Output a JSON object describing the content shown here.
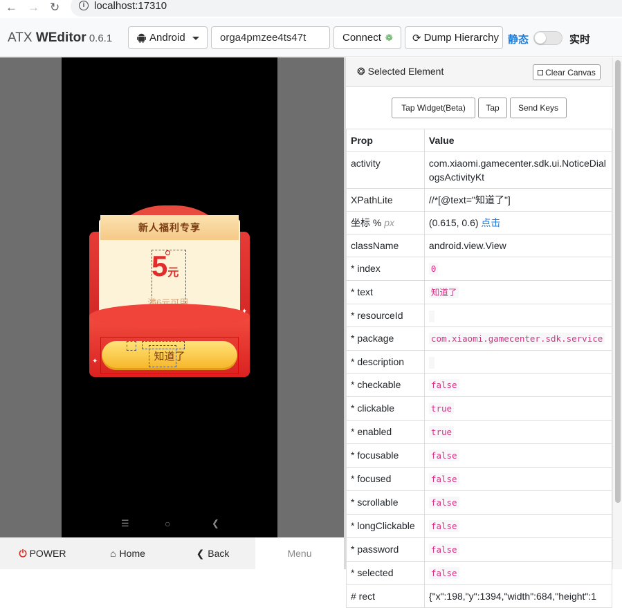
{
  "browser": {
    "url": "localhost:17310",
    "info_icon": "i"
  },
  "header": {
    "brand_prefix": "ATX ",
    "brand_name": "WEditor",
    "version": " 0.6.1",
    "platform": "Android",
    "serial": "orga4pmzee4ts47t",
    "connect_label": "Connect",
    "dump_label": "Dump Hierarchy",
    "mode_static": "静态",
    "mode_live": "实时",
    "live_mode_on": false
  },
  "device": {
    "popup": {
      "title": "新人福利专享",
      "amount": "5",
      "currency": "元",
      "condition": "满6元可用",
      "button": "知道了"
    },
    "controls": {
      "power": "POWER",
      "home": "Home",
      "back": "Back",
      "menu": "Menu"
    }
  },
  "inspector": {
    "title": "Selected Element",
    "clear_canvas": "Clear Canvas",
    "actions": [
      "Tap Widget(Beta)",
      "Tap",
      "Send Keys"
    ],
    "columns": [
      "Prop",
      "Value"
    ],
    "coord_label": "坐标 %",
    "coord_unit": "px",
    "coord_value": "(0.615, 0.6)",
    "coord_link": "点击",
    "rows": [
      {
        "prop": "activity",
        "value": "com.xiaomi.gamecenter.sdk.ui.NoticeDialogsActivityKt",
        "style": "plain"
      },
      {
        "prop": "XPathLite",
        "value": "//*[@text=\"知道了\"]",
        "style": "plain"
      },
      {
        "prop": "className",
        "value": "android.view.View",
        "style": "plain"
      },
      {
        "prop": "* index",
        "value": "0",
        "style": "code"
      },
      {
        "prop": "* text",
        "value": "知道了",
        "style": "code"
      },
      {
        "prop": "* resourceId",
        "value": "",
        "style": "code"
      },
      {
        "prop": "* package",
        "value": "com.xiaomi.gamecenter.sdk.service",
        "style": "code"
      },
      {
        "prop": "* description",
        "value": "",
        "style": "code"
      },
      {
        "prop": "* checkable",
        "value": "false",
        "style": "code"
      },
      {
        "prop": "* clickable",
        "value": "true",
        "style": "code"
      },
      {
        "prop": "* enabled",
        "value": "true",
        "style": "code"
      },
      {
        "prop": "* focusable",
        "value": "false",
        "style": "code"
      },
      {
        "prop": "* focused",
        "value": "false",
        "style": "code"
      },
      {
        "prop": "* scrollable",
        "value": "false",
        "style": "code"
      },
      {
        "prop": "* longClickable",
        "value": "false",
        "style": "code"
      },
      {
        "prop": "* password",
        "value": "false",
        "style": "code"
      },
      {
        "prop": "* selected",
        "value": "false",
        "style": "code"
      },
      {
        "prop": "# rect",
        "value": "{\"x\":198,\"y\":1394,\"width\":684,\"height\":1",
        "style": "plain"
      }
    ]
  },
  "icons": {
    "back": "arrow-left-icon",
    "forward": "arrow-right-icon",
    "reload": "reload-icon",
    "android": "android-icon",
    "connect": "leaf-icon",
    "dump": "refresh-icon",
    "power": "power-icon",
    "home": "home-icon",
    "nav_back": "chevron-left-icon"
  },
  "colors": {
    "accent": "#1f7ed8",
    "code": "#d63384",
    "power": "#d52b1e",
    "selection": "#dd0000"
  }
}
